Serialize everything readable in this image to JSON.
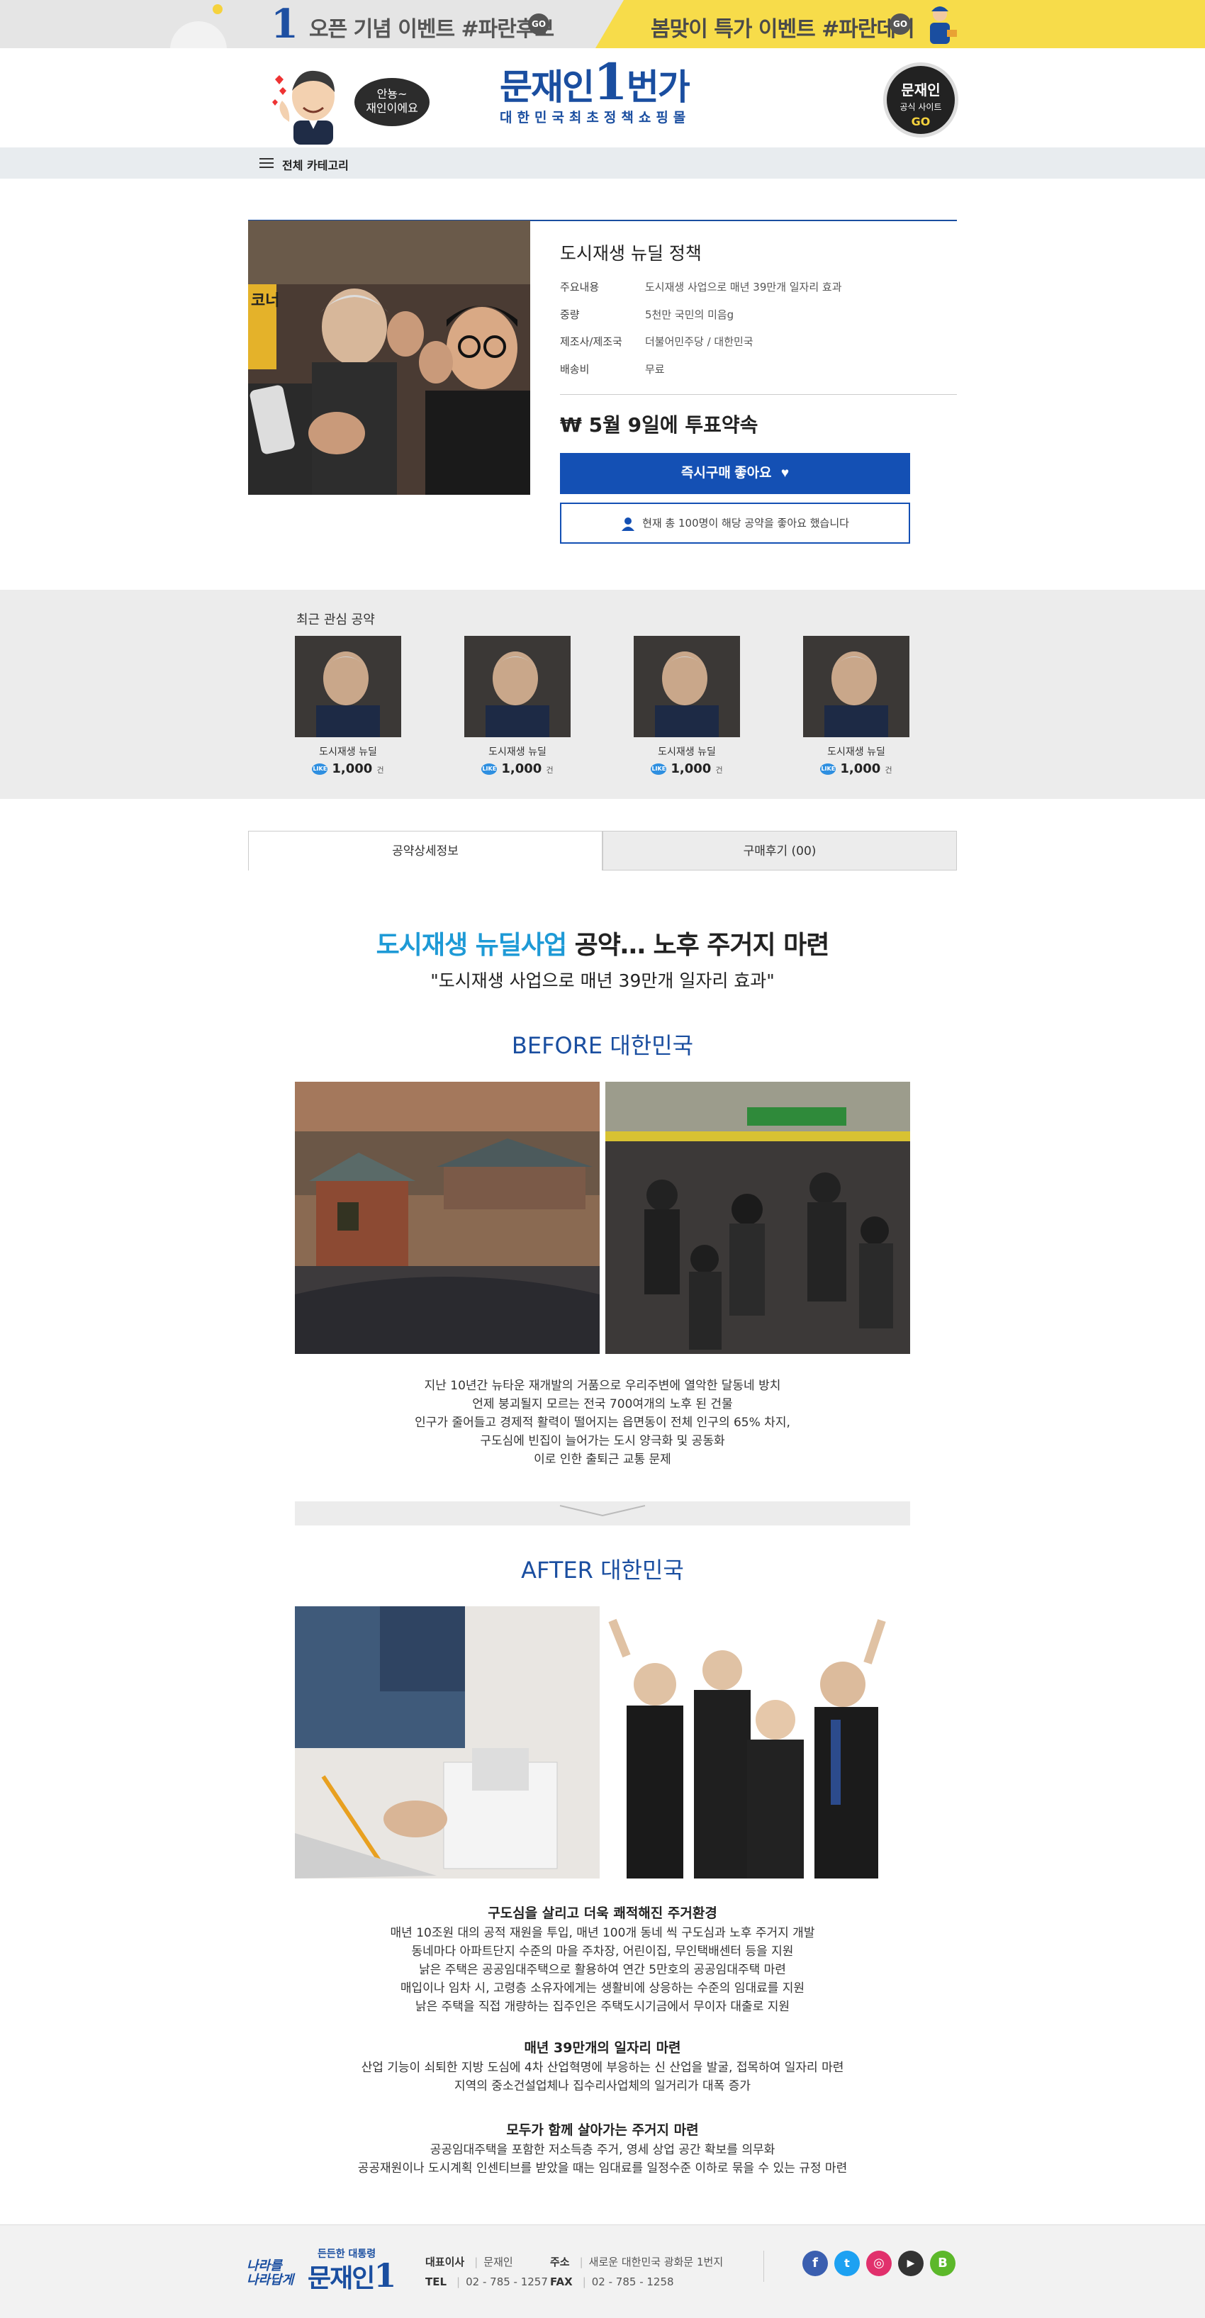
{
  "topbanner": {
    "left_num": "1",
    "left_text": "오픈 기념 이벤트 #파란후보",
    "right_text": "봄맞이 특가 이벤트 #파란데이",
    "go": "GO"
  },
  "header": {
    "bubble_text_1": "안뇽~",
    "bubble_text_2": "재인이에요",
    "logo_main": "문재인",
    "logo_one": "1",
    "logo_suffix": "번가",
    "logo_sub": "대한민국최초정책쇼핑몰",
    "official_1": "문재인",
    "official_2": "공식 사이트",
    "official_3": "GO"
  },
  "category": {
    "label": "전체 카테고리"
  },
  "product": {
    "title": "도시재생 뉴딜 정책",
    "specs": [
      {
        "k": "주요내용",
        "v": "도시재생 사업으로 매년 39만개 일자리 효과"
      },
      {
        "k": "중량",
        "v": "5천만 국민의 미음g"
      },
      {
        "k": "제조사/제조국",
        "v": "더불어민주당 / 대한민국"
      },
      {
        "k": "배송비",
        "v": "무료"
      }
    ],
    "price": "₩ 5월 9일에 투표약속",
    "buy_label": "즉시구매 좋아요",
    "like_note": "현재 총 100명이 해당 공약을 좋아요 했습니다"
  },
  "recent": {
    "title": "최근 관심 공약",
    "items": [
      {
        "name": "도시재생 뉴딜",
        "count": "1,000",
        "unit": "건"
      },
      {
        "name": "도시재생 뉴딜",
        "count": "1,000",
        "unit": "건"
      },
      {
        "name": "도시재생 뉴딜",
        "count": "1,000",
        "unit": "건"
      },
      {
        "name": "도시재생 뉴딜",
        "count": "1,000",
        "unit": "건"
      }
    ],
    "like_chip": "LIKE"
  },
  "tabs": {
    "detail": "공약상세정보",
    "review": "구매후기 (00)"
  },
  "detail": {
    "headline_hl": "도시재생 뉴딜사업",
    "headline_rest": " 공약… 노후 주거지 마련",
    "subheadline": "\"도시재생 사업으로 매년 39만개 일자리 효과\"",
    "before_h_en": "BEFORE",
    "before_h_ko": " 대한민국",
    "before_lines": [
      "지난 10년간 뉴타운 재개발의 거품으로 우리주변에 열악한 달동네 방치",
      "언제 붕괴될지 모르는 전국 700여개의 노후 된 건물",
      "인구가 줄어들고 경제적 활력이 떨어지는 읍면동이 전체 인구의 65% 차지,",
      "구도심에 빈집이 늘어가는 도시 양극화 및 공동화",
      "이로 인한 출퇴근 교통 문제"
    ],
    "after_h_en": "AFTER",
    "after_h_ko": " 대한민국",
    "blocks": [
      {
        "title": "구도심을 살리고 더욱 쾌적해진 주거환경",
        "lines": [
          "매년 10조원 대의 공적 재원을 투입, 매년 100개 동네 씩 구도심과 노후 주거지 개발",
          "동네마다 아파트단지 수준의 마을 주차장, 어린이집, 무인택배센터 등을 지원",
          "낡은 주택은 공공임대주택으로 활용하여 연간 5만호의 공공임대주택 마련",
          "매입이나 임차 시, 고령층 소유자에게는 생활비에 상응하는 수준의 임대료를 지원",
          "낡은 주택을 직접 개량하는 집주인은 주택도시기금에서 무이자 대출로 지원"
        ]
      },
      {
        "title": "매년 39만개의 일자리 마련",
        "lines": [
          "산업 기능이 쇠퇴한 지방 도심에 4차 산업혁명에 부응하는 신 산업을 발굴, 접목하여 일자리 마련",
          "지역의 중소건설업체나 집수리사업체의 일거리가 대폭 증가"
        ]
      },
      {
        "title": "모두가 함께 살아가는 주거지 마련",
        "lines": [
          "공공임대주택을 포함한 저소득층 주거, 영세 상업 공간 확보를 의무화",
          "공공재원이나 도시계획 인센티브를 받았을 때는 임대료를 일정수준 이하로 묶을 수 있는 규정 마련"
        ]
      }
    ]
  },
  "footer": {
    "slogan_1": "나라를",
    "slogan_2": "나라답게",
    "logo_small": "든든한 대통령",
    "logo_big": "문재인",
    "logo_one": "1",
    "ceo_label": "대표이사",
    "ceo": "문재인",
    "addr_label": "주소",
    "addr": "새로운 대한민국 광화문 1번지",
    "tel_label": "TEL",
    "tel": "02 - 785 - 1257",
    "fax_label": "FAX",
    "fax": "02 - 785 - 1258",
    "sns": [
      "f",
      "t",
      "◎",
      "▶",
      "B"
    ]
  },
  "colors": {
    "brand_blue": "#1a4ea0",
    "button_blue": "#1450b4",
    "highlight": "#1e9ad6",
    "banner_yellow": "#f7dc4a"
  }
}
